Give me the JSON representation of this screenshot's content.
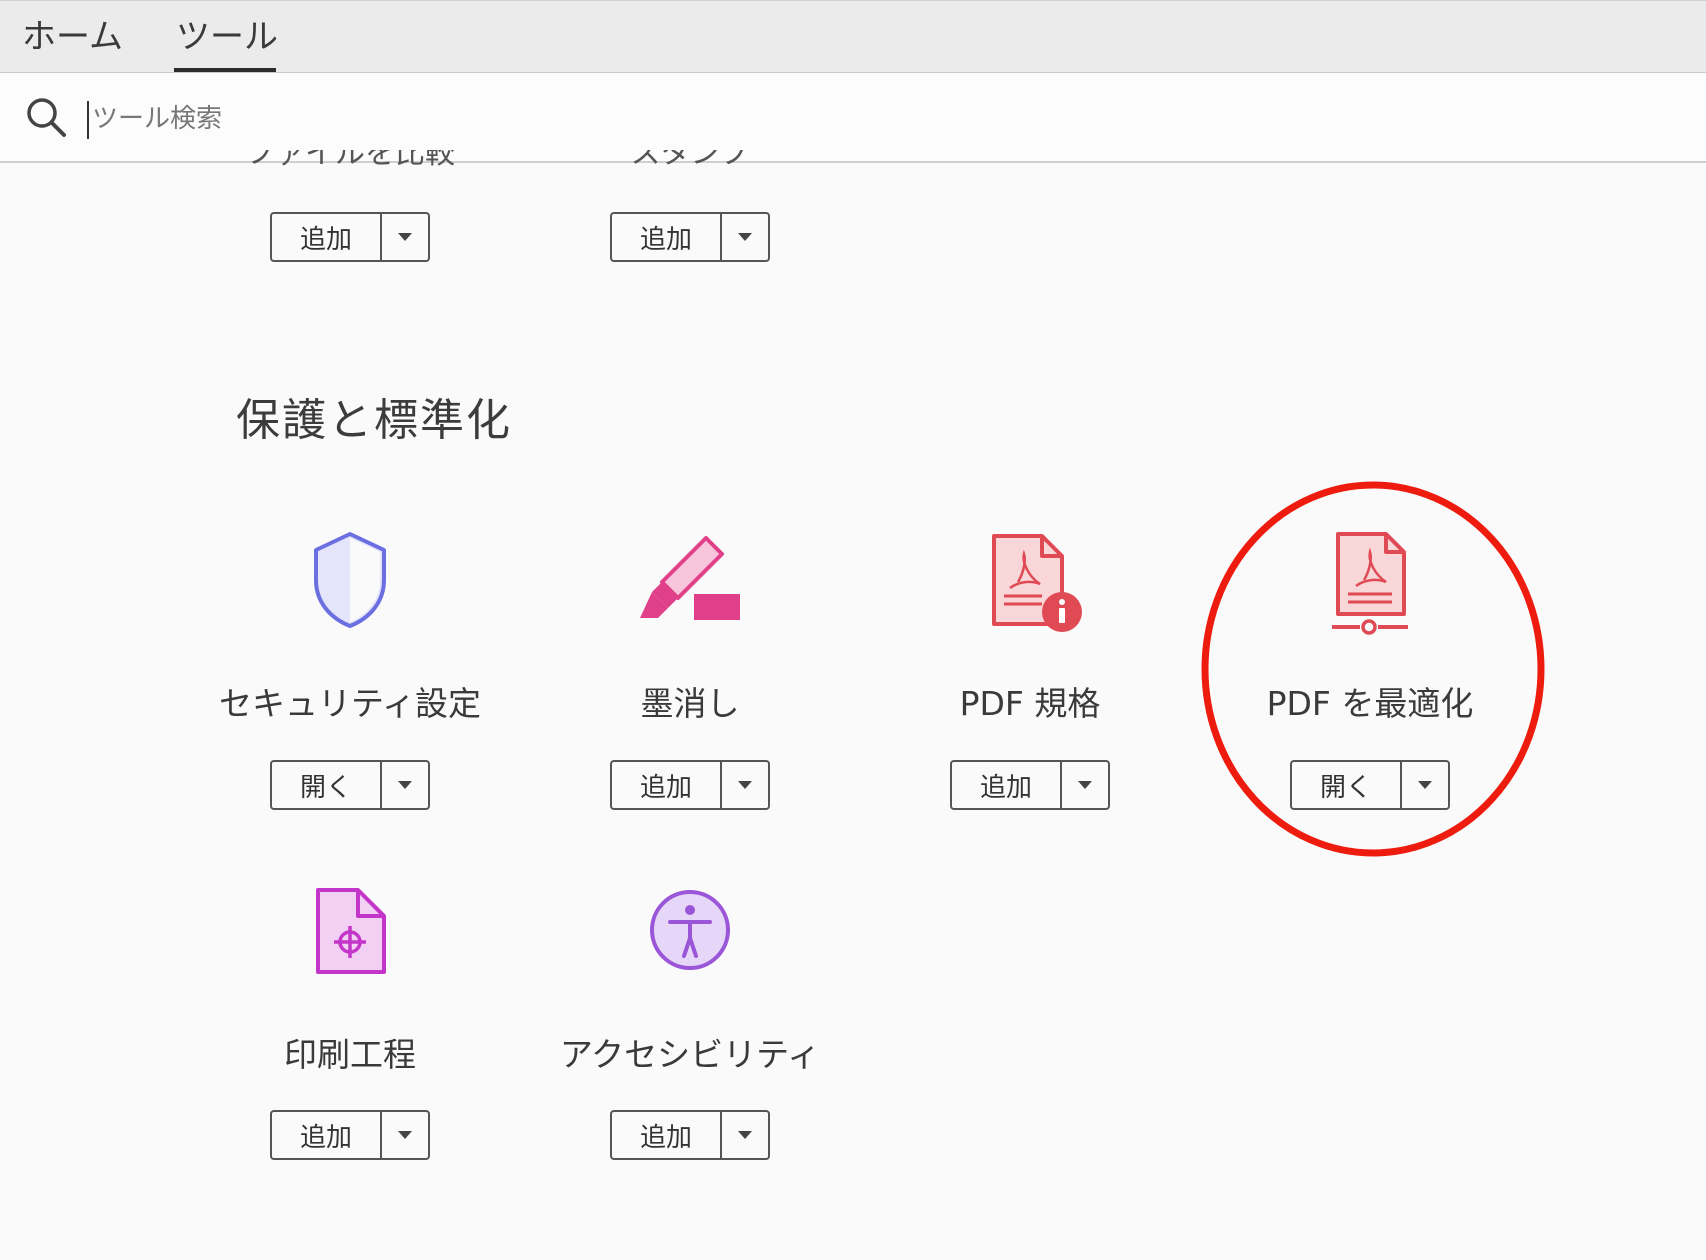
{
  "tabs": {
    "home": "ホーム",
    "tools": "ツール"
  },
  "search": {
    "placeholder": "ツール検索",
    "value": ""
  },
  "top_row": {
    "label_left": "ファイルを比較",
    "label_right": "スタンプ",
    "buttons": [
      {
        "label": "追加"
      },
      {
        "label": "追加"
      }
    ]
  },
  "section": {
    "title": "保護と標準化",
    "tools": [
      {
        "name": "セキュリティ設定",
        "button": "開く",
        "icon": "shield-icon",
        "color": "#6b6fe0"
      },
      {
        "name": "墨消し",
        "button": "追加",
        "icon": "redact-marker-icon",
        "color": "#e0408a"
      },
      {
        "name": "PDF 規格",
        "button": "追加",
        "icon": "pdf-standards-icon",
        "color": "#e04a55"
      },
      {
        "name": "PDF を最適化",
        "button": "開く",
        "icon": "optimize-pdf-icon",
        "color": "#e04a55"
      },
      {
        "name": "印刷工程",
        "button": "追加",
        "icon": "print-production-icon",
        "color": "#c435c9"
      },
      {
        "name": "アクセシビリティ",
        "button": "追加",
        "icon": "accessibility-icon",
        "color": "#9a55d8"
      }
    ]
  },
  "annotation": {
    "highlight_color": "#ee1c0e"
  }
}
